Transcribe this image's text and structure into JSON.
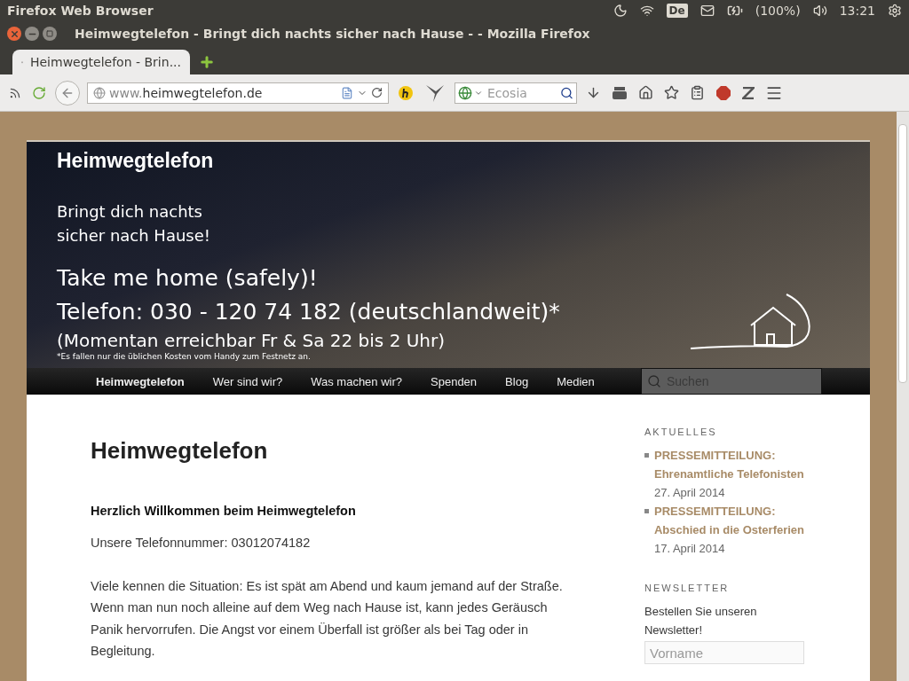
{
  "top_panel": {
    "app_name": "Firefox Web Browser",
    "keyboard": "De",
    "battery": "(100%)",
    "time": "13:21"
  },
  "window": {
    "title": "Heimwegtelefon - Bringt dich nachts sicher nach Hause - - Mozilla Firefox"
  },
  "tabs": [
    {
      "label": "Heimwegtelefon - Brin...",
      "selected": true
    }
  ],
  "address_bar": {
    "prefix": "www.",
    "domain": "heimwegtelefon.de"
  },
  "search": {
    "placeholder": "Ecosia"
  },
  "banner": {
    "site_title": "Heimwegtelefon",
    "tagline_lines": [
      "Bringt dich nachts",
      "sicher nach Hause!"
    ],
    "lines": [
      "Take me home (safely)!",
      "Telefon: 030 - 120 74 182 (deutschlandweit)*",
      "(Momentan erreichbar Fr & Sa 22 bis 2 Uhr)"
    ],
    "footnote": "*Es fallen nur die üblichen Kosten vom Handy zum Festnetz an."
  },
  "menu": [
    {
      "label": "Heimwegtelefon",
      "selected": true
    },
    {
      "label": "Wer sind wir?",
      "selected": false
    },
    {
      "label": "Was machen wir?",
      "selected": false
    },
    {
      "label": "Spenden",
      "selected": false
    },
    {
      "label": "Blog",
      "selected": false
    },
    {
      "label": "Medien",
      "selected": false
    }
  ],
  "site_search": {
    "placeholder": "Suchen"
  },
  "article": {
    "title": "Heimwegtelefon",
    "intro": "Herzlich Willkommen beim Heimwegtelefon",
    "phone": "Unsere Telefonnummer: 03012074182",
    "body": "Viele kennen die Situation: Es ist spät am Abend und kaum jemand auf der Straße. Wenn man nun noch alleine auf dem Weg nach Hause ist, kann jedes Geräusch Panik hervorrufen. Die Angst vor einem Überfall ist größer als bei Tag oder in Begleitung."
  },
  "sidebar": {
    "news_heading": "AKTUELLES",
    "news": [
      {
        "title": "PRESSEMITTEILUNG: Ehrenamtliche Telefonisten",
        "date": "27. April 2014"
      },
      {
        "title": "PRESSEMITTEILUNG: Abschied in die Osterferien",
        "date": "17. April 2014"
      }
    ],
    "newsletter_heading": "NEWSLETTER",
    "newsletter_text": "Bestellen Sie unseren Newsletter!",
    "first_name": {
      "placeholder": "Vorname"
    }
  }
}
